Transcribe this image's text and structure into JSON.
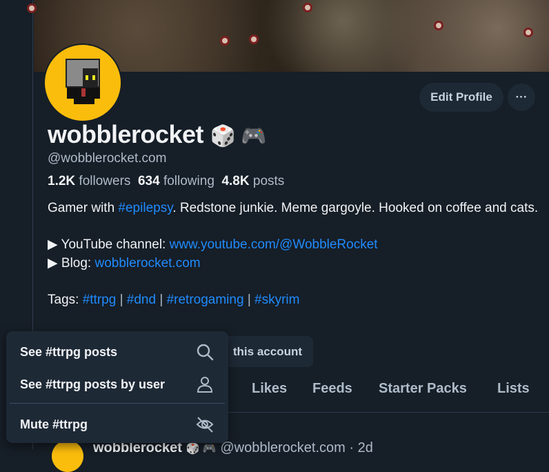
{
  "profile": {
    "display_name": "wobblerocket",
    "name_emojis": "🎲 🎮",
    "handle": "@wobblerocket.com",
    "followers_count": "1.2K",
    "followers_label": "followers",
    "following_count": "634",
    "following_label": "following",
    "posts_count": "4.8K",
    "posts_label": "posts"
  },
  "actions": {
    "edit_profile": "Edit Profile",
    "more": "···",
    "hidden_button_suffix": "this account"
  },
  "bio": {
    "line1_pre": "Gamer with ",
    "line1_tag": "#epilepsy",
    "line1_post": ". Redstone junkie. Meme gargoyle. Hooked on coffee and cats.",
    "youtube_label": "▶ YouTube channel: ",
    "youtube_link": "www.youtube.com/@WobbleRocket",
    "blog_label": "▶ Blog: ",
    "blog_link": "wobblerocket.com",
    "tags_label": "Tags: ",
    "tags": [
      "#ttrpg",
      "#dnd",
      "#retrogaming",
      "#skyrim"
    ],
    "tag_sep": "|"
  },
  "tabs": [
    "Likes",
    "Feeds",
    "Starter Packs",
    "Lists"
  ],
  "menu": {
    "items": [
      {
        "label": "See #ttrpg posts",
        "icon": "search-icon"
      },
      {
        "label": "See #ttrpg posts by user",
        "icon": "person-icon"
      },
      {
        "label": "Mute #ttrpg",
        "icon": "eye-slash-icon"
      }
    ]
  },
  "post": {
    "author": "wobblerocket",
    "handle": "@wobblerocket.com",
    "time": "· 2d"
  },
  "colors": {
    "background": "#161e27",
    "link": "#208bfe",
    "menu": "#1e2936",
    "avatar": "#fbbd0c"
  }
}
